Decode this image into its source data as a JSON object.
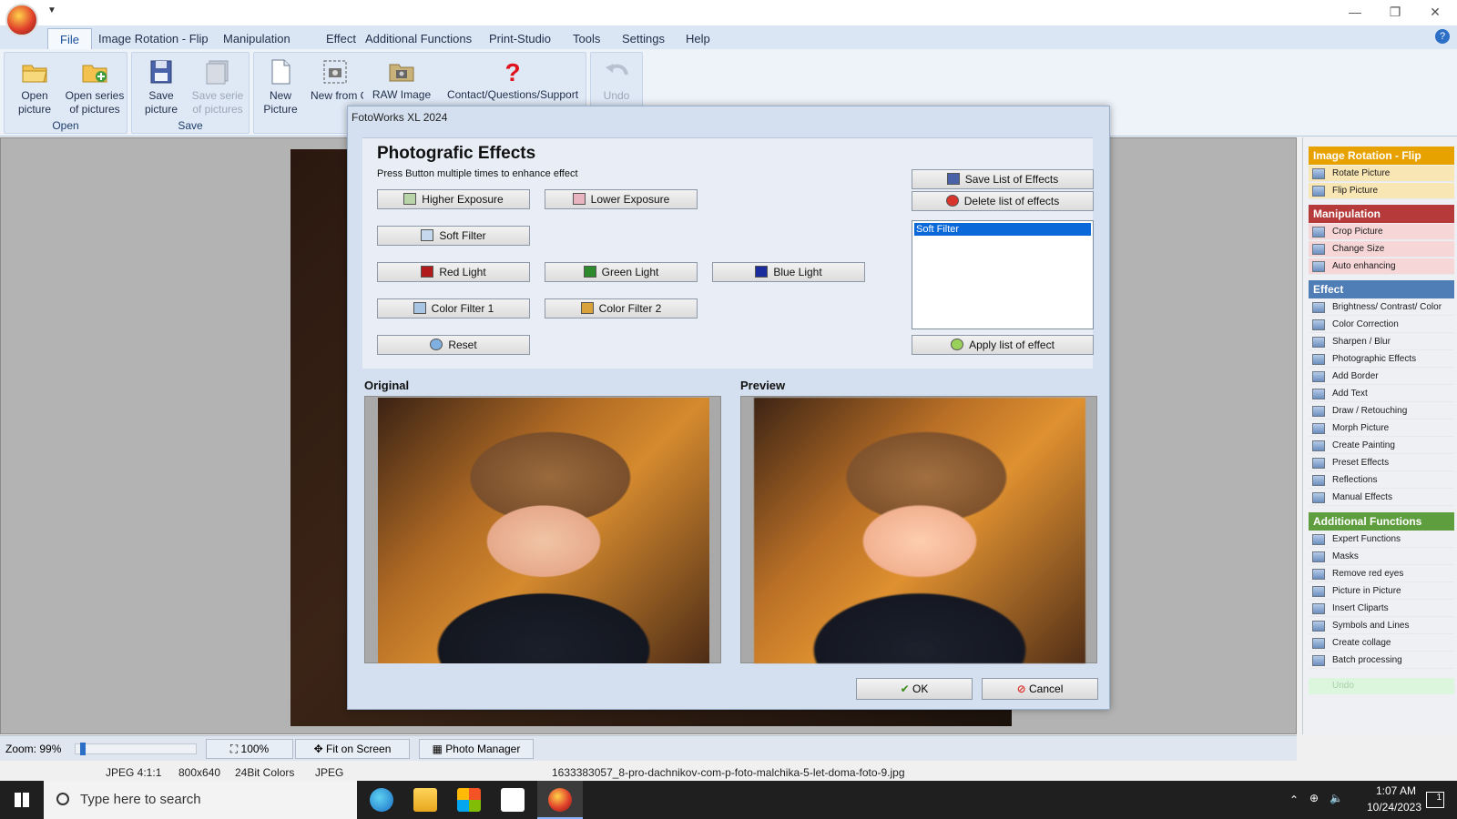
{
  "window": {
    "title": "FotoWorks XL 2024"
  },
  "tabs": [
    "File",
    "Image Rotation - Flip",
    "Manipulation",
    "Effect",
    "Additional Functions",
    "Print-Studio",
    "Tools",
    "Settings",
    "Help"
  ],
  "ribbon": {
    "open_group": {
      "label": "Open",
      "open_picture": "Open picture",
      "open_series": "Open series of pictures"
    },
    "save_group": {
      "label": "Save",
      "save_picture": "Save picture",
      "save_serie": "Save serie of pictures"
    },
    "new_picture": "New Picture",
    "new_from_clipboard": "New from Clipboard",
    "raw_image": "RAW Image",
    "support": "Contact/Questions/Support",
    "undo": "Undo"
  },
  "dialog": {
    "title": "FotoWorks XL 2024",
    "heading": "Photografic Effects",
    "subtitle": "Press Button multiple times to enhance effect",
    "buttons": {
      "higher_exposure": "Higher Exposure",
      "lower_exposure": "Lower Exposure",
      "soft_filter": "Soft Filter",
      "red_light": "Red Light",
      "green_light": "Green Light",
      "blue_light": "Blue Light",
      "color_filter_1": "Color Filter 1",
      "color_filter_2": "Color Filter 2",
      "reset": "Reset",
      "save_list": "Save List of Effects",
      "delete_list": "Delete list of effects",
      "apply_list": "Apply list of effect",
      "ok": "OK",
      "cancel": "Cancel"
    },
    "effects_list": [
      "Soft Filter"
    ],
    "original_label": "Original",
    "preview_label": "Preview"
  },
  "zoombar": {
    "zoom": "Zoom: 99%",
    "zoom_level": 0.02,
    "btn_100": "100%",
    "fit": "Fit on Screen",
    "photo_manager": "Photo Manager"
  },
  "status": {
    "format": "JPEG  4:1:1",
    "dimensions": "800x640",
    "colors": "24Bit Colors",
    "type": "JPEG",
    "filename": "1633383057_8-pro-dachnikov-com-p-foto-malchika-5-let-doma-foto-9.jpg"
  },
  "right_panel": {
    "sections": [
      {
        "title": "Image Rotation - Flip",
        "color": "#e8a200",
        "items": [
          "Rotate Picture",
          "Flip Picture"
        ]
      },
      {
        "title": "Manipulation",
        "color": "#b63a3a",
        "items": [
          "Crop Picture",
          "Change Size",
          "Auto enhancing"
        ]
      },
      {
        "title": "Effect",
        "color": "#4f7db5",
        "items": [
          "Brightness/ Contrast/ Color",
          "Color Correction",
          "Sharpen / Blur",
          "Photographic Effects",
          "Add Border",
          "Add Text",
          "Draw / Retouching",
          "Morph Picture",
          "Create Painting",
          "Preset Effects",
          "Reflections",
          "Manual Effects"
        ]
      },
      {
        "title": "Additional Functions",
        "color": "#5f9e3f",
        "items": [
          "Expert Functions",
          "Masks",
          "Remove red eyes",
          "Picture in Picture",
          "Insert Cliparts",
          "Symbols and Lines",
          "Create collage",
          "Batch processing"
        ]
      }
    ],
    "undo": "Undo"
  },
  "taskbar": {
    "search_placeholder": "Type here to search",
    "time": "1:07 AM",
    "date": "10/24/2023",
    "notification_count": "1"
  }
}
